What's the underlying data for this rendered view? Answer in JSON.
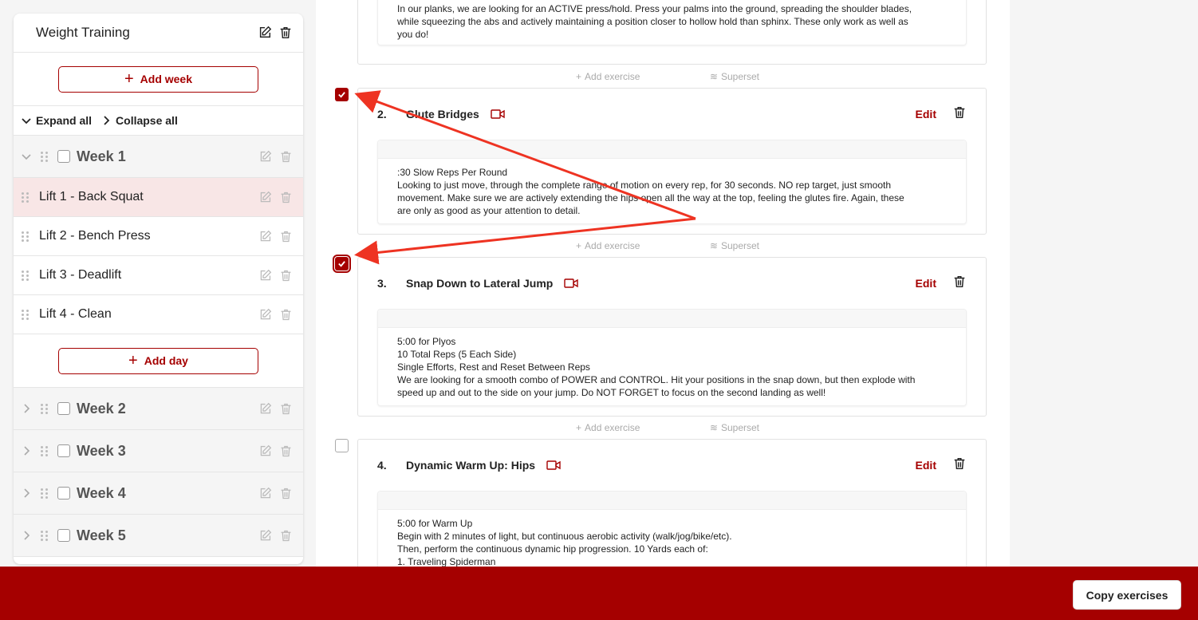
{
  "sidebar": {
    "program_title": "Weight Training",
    "add_week_label": "Add week",
    "expand_all_label": "Expand all",
    "collapse_all_label": "Collapse all",
    "week1": {
      "label": "Week 1",
      "expanded": true
    },
    "days": [
      {
        "label": "Lift 1 - Back Squat",
        "active": true
      },
      {
        "label": "Lift 2 - Bench Press",
        "active": false
      },
      {
        "label": "Lift 3 - Deadlift",
        "active": false
      },
      {
        "label": "Lift 4 - Clean",
        "active": false
      }
    ],
    "add_day_label": "Add day",
    "other_weeks": [
      {
        "label": "Week 2",
        "expanded": false
      },
      {
        "label": "Week 3",
        "expanded": false
      },
      {
        "label": "Week 4",
        "expanded": false
      },
      {
        "label": "Week 5",
        "expanded": false
      }
    ]
  },
  "main": {
    "add_exercise_label": "Add exercise",
    "superset_label": "Superset",
    "edit_label": "Edit",
    "exercises": [
      {
        "notes_tail": "In our planks, we are looking for an ACTIVE press/hold. Press your palms into the ground, spreading the shoulder blades,\nwhile squeezing the abs and actively maintaining a position closer to hollow hold than sphinx. These only work as well as\nyou do!"
      },
      {
        "number": "2.",
        "name": "Glute Bridges",
        "selected": true,
        "notes": ":30 Slow Reps Per Round\nLooking to just move, through the complete range of motion on every rep, for 30 seconds. NO rep target, just smooth\nmovement. Make sure we are actively extending the hips open all the way at the top, feeling the glutes fire. Again, these\nare only as good as your attention to detail."
      },
      {
        "number": "3.",
        "name": "Snap Down to Lateral Jump",
        "selected": true,
        "notes": "5:00 for Plyos\n10 Total Reps (5 Each Side)\nSingle Efforts, Rest and Reset Between Reps\nWe are looking for a smooth combo of POWER and CONTROL. Hit your positions in the snap down, but then explode with\nspeed up and out to the side on your jump. Do NOT FORGET to focus on the second landing as well!"
      },
      {
        "number": "4.",
        "name": "Dynamic Warm Up: Hips",
        "selected": false,
        "notes": "5:00 for Warm Up\nBegin with 2 minutes of light, but continuous aerobic activity (walk/jog/bike/etc).\nThen, perform the continuous dynamic hip progression. 10 Yards each of:\n1. Traveling Spiderman"
      }
    ]
  },
  "footer": {
    "copy_label": "Copy exercises"
  },
  "colors": {
    "accent": "#a50000",
    "arrow": "#ee3322"
  },
  "icons": [
    "edit-icon",
    "trash-icon",
    "plus-icon",
    "chevron-down-icon",
    "chevron-right-icon",
    "drag-handle-icon",
    "video-icon",
    "superset-icon",
    "check-icon"
  ]
}
